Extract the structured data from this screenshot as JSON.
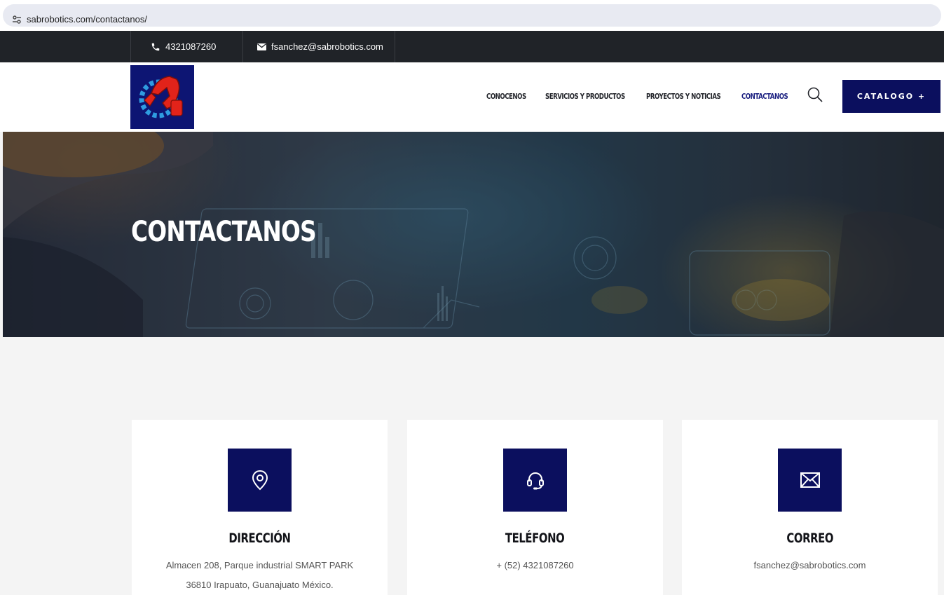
{
  "browser": {
    "url": "sabrobotics.com/contactanos/"
  },
  "topbar": {
    "phone": "4321087260",
    "email": "fsanchez@sabrobotics.com"
  },
  "nav": {
    "items": [
      {
        "label": "CONOCENOS"
      },
      {
        "label": "SERVICIOS Y PRODUCTOS"
      },
      {
        "label": "PROYECTOS Y NOTICIAS"
      },
      {
        "label": "CONTACTANOS",
        "active": true
      }
    ],
    "catalog_label": "CATALOGO +"
  },
  "hero": {
    "title": "CONTACTANOS"
  },
  "cards": [
    {
      "icon": "map-pin-icon",
      "title": "DIRECCIÓN",
      "lines": [
        "Almacen 208, Parque industrial SMART PARK",
        "36810 Irapuato, Guanajuato México."
      ]
    },
    {
      "icon": "headset-icon",
      "title": "TELÉFONO",
      "lines": [
        "+ (52) 4321087260"
      ]
    },
    {
      "icon": "envelope-icon",
      "title": "CORREO",
      "lines": [
        "fsanchez@sabrobotics.com"
      ]
    }
  ],
  "colors": {
    "brand_navy": "#0b0f5e",
    "topbar_bg": "#202328",
    "page_bg": "#f4f4f4"
  }
}
